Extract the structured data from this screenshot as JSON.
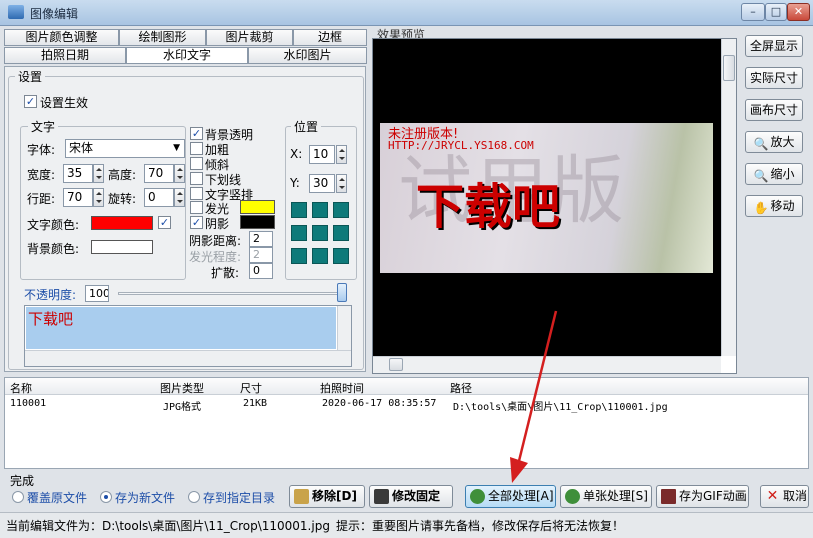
{
  "window": {
    "title": "图像编辑",
    "min": "–",
    "max": "□",
    "close": "✕"
  },
  "tabs_row1": [
    "图片颜色调整",
    "绘制图形",
    "图片裁剪",
    "边框"
  ],
  "tabs_row2": [
    "拍照日期",
    "水印文字",
    "水印图片"
  ],
  "settings": {
    "group_title": "设置",
    "enable_label": "设置生效",
    "text_group": {
      "title": "文字",
      "font_label": "字体:",
      "font_value": "宋体",
      "width_label": "宽度:",
      "width_value": "35",
      "height_label": "高度:",
      "height_value": "70",
      "linespace_label": "行距:",
      "linespace_value": "70",
      "rotate_label": "旋转:",
      "rotate_value": "0",
      "text_color_label": "文字颜色:",
      "text_color": "#ff0000",
      "bg_color_label": "背景颜色:",
      "bg_color": "#ffffff"
    },
    "options": {
      "transparent_bg": "背景透明",
      "bold": "加粗",
      "italic": "倾斜",
      "underline": "下划线",
      "vertical": "文字竖排",
      "glow": "发光",
      "shadow": "阴影",
      "glow_color": "#ffff00",
      "shadow_color": "#000000",
      "shadow_distance_label": "阴影距离:",
      "shadow_distance": "2",
      "glow_level_label": "发光程度:",
      "glow_level": "2",
      "spread_label": "扩散:",
      "spread": "0"
    },
    "position": {
      "title": "位置",
      "x_label": "X:",
      "x_value": "10",
      "y_label": "Y:",
      "y_value": "30"
    },
    "opacity_label": "不透明度:",
    "opacity_value": "100",
    "watermark_text": "下载吧"
  },
  "preview": {
    "title": "效果预览",
    "line1": "未注册版本!",
    "line2": "HTTP://JRYCL.YS168.COM",
    "big_text": "下载吧",
    "bg_watermark": "试用版"
  },
  "side_buttons": [
    "全屏显示",
    "实际尺寸",
    "画布尺寸",
    "放大",
    "缩小",
    "移动"
  ],
  "file_table": {
    "headers": [
      "名称",
      "图片类型",
      "尺寸",
      "拍照时间",
      "路径"
    ],
    "rows": [
      [
        "110001",
        "JPG格式",
        "21KB",
        "2020-06-17 08:35:57",
        "D:\\tools\\桌面\\图片\\11_Crop\\110001.jpg"
      ]
    ]
  },
  "complete": {
    "title": "完成",
    "radio_overwrite": "覆盖原文件",
    "radio_save_new": "存为新文件",
    "radio_save_dir": "存到指定目录"
  },
  "buttons": {
    "remove": "移除[D]",
    "modify_fixed": "修改固定",
    "process_all": "全部处理[A]",
    "process_single": "单张处理[S]",
    "save_gif": "存为GIF动画",
    "cancel": "取消"
  },
  "status": {
    "current_file": "当前编辑文件为：D:\\tools\\桌面\\图片\\11_Crop\\110001.jpg",
    "hint": "提示：重要图片请事先备档，修改保存后将无法恢复！"
  },
  "colors": {
    "accent": "#1d4ea8",
    "watermark_red": "#cc0000",
    "process_all_highlight": "#bfe0f7"
  }
}
